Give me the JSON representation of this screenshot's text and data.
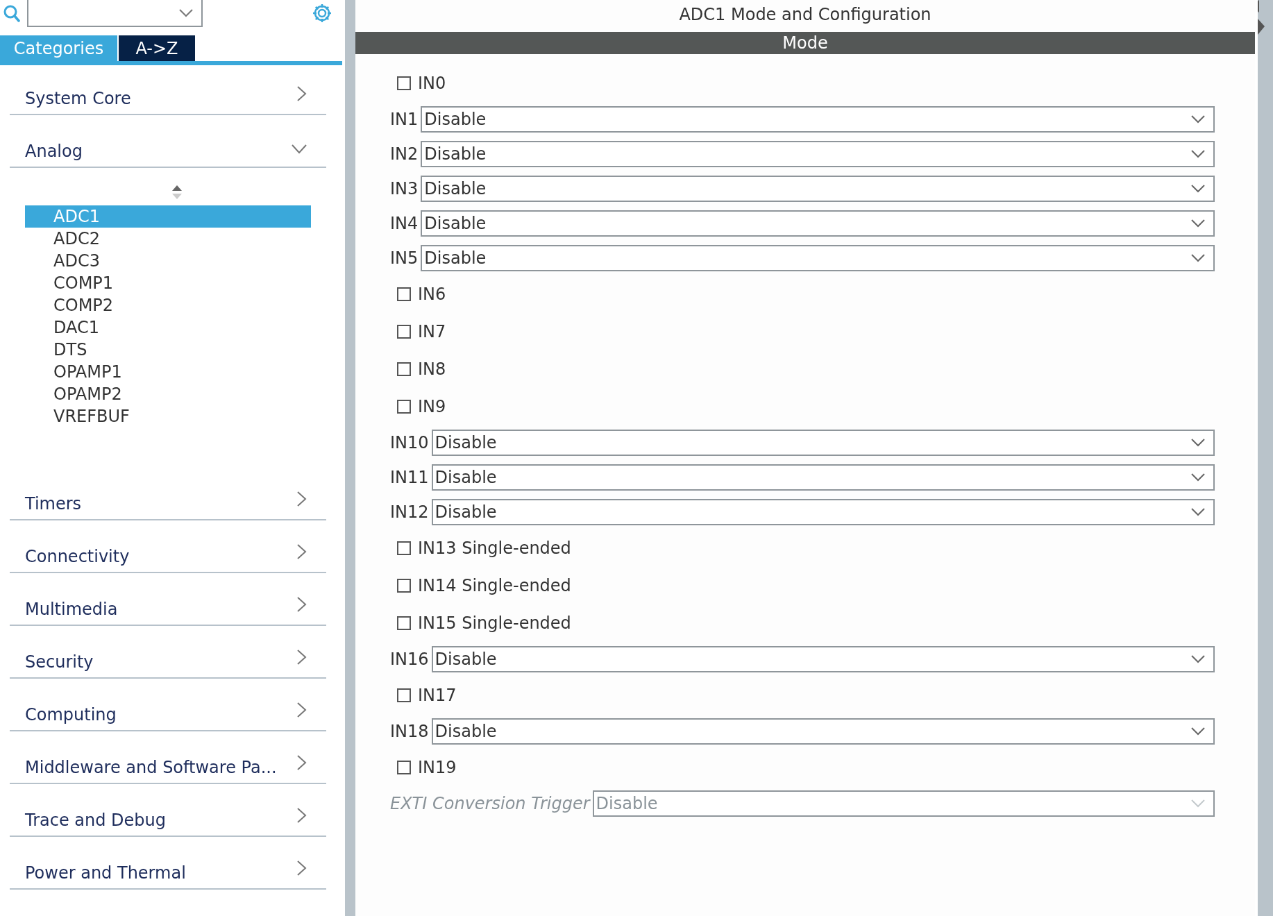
{
  "tabs": [
    {
      "label": "Categories",
      "selected": true
    },
    {
      "label": "A->Z",
      "selected": false
    }
  ],
  "categories": [
    {
      "label": "System Core",
      "expanded": false
    },
    {
      "label": "Analog",
      "expanded": true,
      "items": [
        {
          "label": "ADC1",
          "selected": true
        },
        {
          "label": "ADC2",
          "selected": false
        },
        {
          "label": "ADC3",
          "selected": false
        },
        {
          "label": "COMP1",
          "selected": false
        },
        {
          "label": "COMP2",
          "selected": false
        },
        {
          "label": "DAC1",
          "selected": false
        },
        {
          "label": "DTS",
          "selected": false
        },
        {
          "label": "OPAMP1",
          "selected": false
        },
        {
          "label": "OPAMP2",
          "selected": false
        },
        {
          "label": "VREFBUF",
          "selected": false
        }
      ]
    },
    {
      "label": "Timers",
      "expanded": false
    },
    {
      "label": "Connectivity",
      "expanded": false
    },
    {
      "label": "Multimedia",
      "expanded": false
    },
    {
      "label": "Security",
      "expanded": false
    },
    {
      "label": "Computing",
      "expanded": false
    },
    {
      "label": "Middleware and Software Pa...",
      "expanded": false
    },
    {
      "label": "Trace and Debug",
      "expanded": false
    },
    {
      "label": "Power and Thermal",
      "expanded": false
    }
  ],
  "panel": {
    "title": "ADC1 Mode and Configuration",
    "section": "Mode",
    "rows": [
      {
        "kind": "checkbox",
        "label": "IN0",
        "checked": false
      },
      {
        "kind": "select",
        "label": "IN1",
        "value": "Disable",
        "disabled": false
      },
      {
        "kind": "select",
        "label": "IN2",
        "value": "Disable",
        "disabled": false
      },
      {
        "kind": "select",
        "label": "IN3",
        "value": "Disable",
        "disabled": false
      },
      {
        "kind": "select",
        "label": "IN4",
        "value": "Disable",
        "disabled": false
      },
      {
        "kind": "select",
        "label": "IN5",
        "value": "Disable",
        "disabled": false
      },
      {
        "kind": "checkbox",
        "label": "IN6",
        "checked": false
      },
      {
        "kind": "checkbox",
        "label": "IN7",
        "checked": false
      },
      {
        "kind": "checkbox",
        "label": "IN8",
        "checked": false
      },
      {
        "kind": "checkbox",
        "label": "IN9",
        "checked": false
      },
      {
        "kind": "select",
        "label": "IN10",
        "value": "Disable",
        "disabled": false
      },
      {
        "kind": "select",
        "label": "IN11",
        "value": "Disable",
        "disabled": false
      },
      {
        "kind": "select",
        "label": "IN12",
        "value": "Disable",
        "disabled": false
      },
      {
        "kind": "checkbox",
        "label": "IN13 Single-ended",
        "checked": false
      },
      {
        "kind": "checkbox",
        "label": "IN14 Single-ended",
        "checked": false
      },
      {
        "kind": "checkbox",
        "label": "IN15 Single-ended",
        "checked": false
      },
      {
        "kind": "select",
        "label": "IN16",
        "value": "Disable",
        "disabled": false
      },
      {
        "kind": "checkbox",
        "label": "IN17",
        "checked": false
      },
      {
        "kind": "select",
        "label": "IN18",
        "value": "Disable",
        "disabled": false
      },
      {
        "kind": "checkbox",
        "label": "IN19",
        "checked": false
      },
      {
        "kind": "select",
        "label": "EXTI Conversion Trigger",
        "value": "Disable",
        "disabled": true
      }
    ]
  }
}
